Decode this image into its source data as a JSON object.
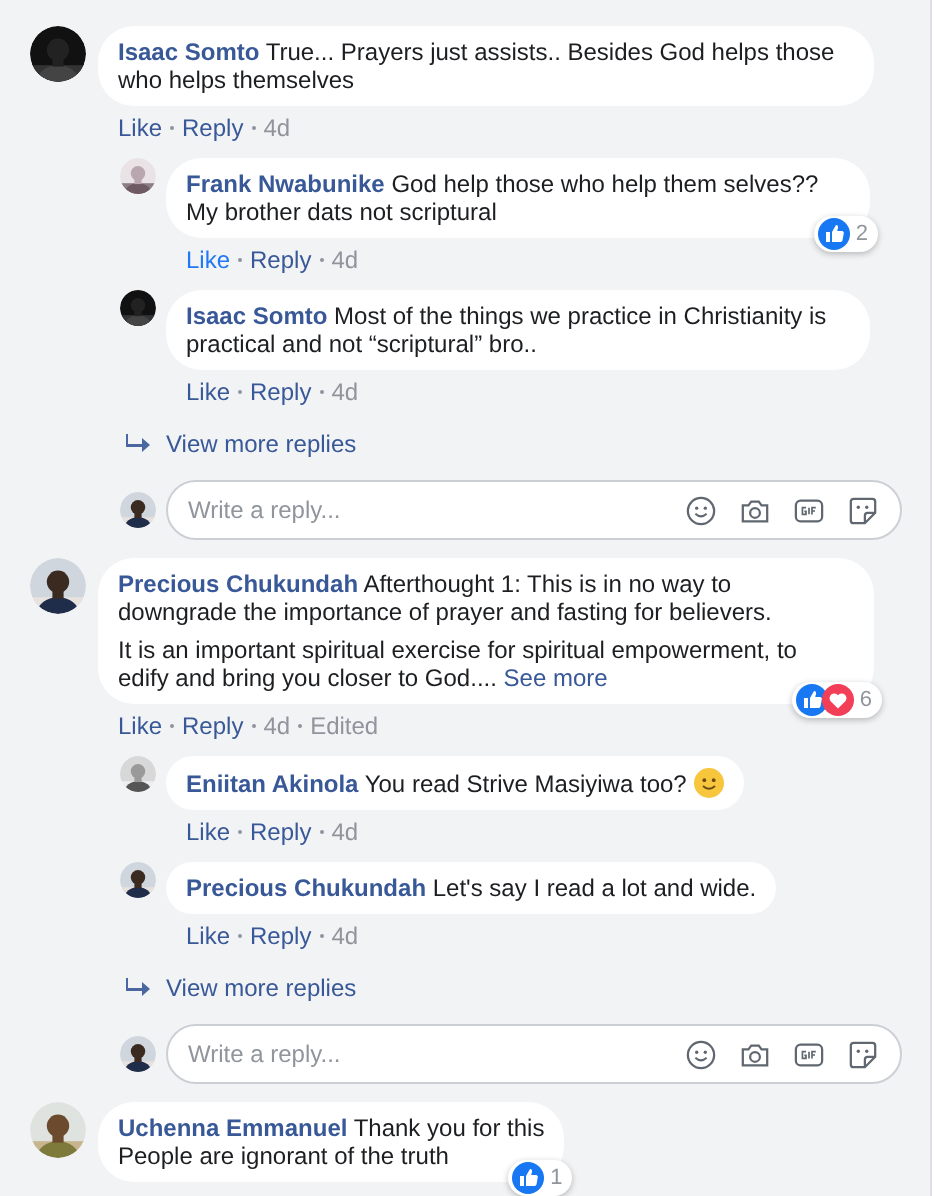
{
  "thread": [
    {
      "kind": "comment",
      "author": "Isaac Somto",
      "text": "True... Prayers just assists.. Besides God helps those who helps themselves",
      "actions": {
        "like": "Like",
        "reply": "Reply",
        "time": "4d",
        "liked": false
      }
    },
    {
      "kind": "reply",
      "author": "Frank Nwabunike",
      "text": "God help those who help them selves?? My brother dats not scriptural",
      "actions": {
        "like": "Like",
        "reply": "Reply",
        "time": "4d",
        "liked": true
      },
      "reactions": {
        "like": true,
        "count": "2"
      }
    },
    {
      "kind": "reply",
      "author": "Isaac Somto",
      "text": "Most of the things we practice in Christianity is practical and not “scriptural” bro..",
      "actions": {
        "like": "Like",
        "reply": "Reply",
        "time": "4d",
        "liked": false
      }
    },
    {
      "kind": "more",
      "label": "View more replies"
    },
    {
      "kind": "composer",
      "placeholder": "Write a reply..."
    },
    {
      "kind": "comment",
      "author": "Precious Chukundah",
      "paragraphs": [
        "Afterthought 1: This is in no way to downgrade the importance of prayer and fasting for believers.",
        "It is an important spiritual exercise for spiritual empowerment, to edify and bring you closer to God...."
      ],
      "see_more": "See more",
      "actions": {
        "like": "Like",
        "reply": "Reply",
        "time": "4d",
        "edited": "Edited",
        "liked": false
      },
      "reactions": {
        "like": true,
        "love": true,
        "count": "6"
      }
    },
    {
      "kind": "reply",
      "author": "Eniitan Akinola",
      "text": "You read Strive Masiyiwa too?",
      "emoji": true,
      "actions": {
        "like": "Like",
        "reply": "Reply",
        "time": "4d",
        "liked": false
      }
    },
    {
      "kind": "reply",
      "author": "Precious Chukundah",
      "text": "Let's say I read a lot and wide.",
      "actions": {
        "like": "Like",
        "reply": "Reply",
        "time": "4d",
        "liked": false
      }
    },
    {
      "kind": "more",
      "label": "View more replies"
    },
    {
      "kind": "composer",
      "placeholder": "Write a reply..."
    },
    {
      "kind": "comment",
      "author": "Uchenna Emmanuel",
      "text": "Thank you for this\nPeople are ignorant of the truth",
      "reactions": {
        "like": true,
        "count": "1"
      }
    }
  ]
}
